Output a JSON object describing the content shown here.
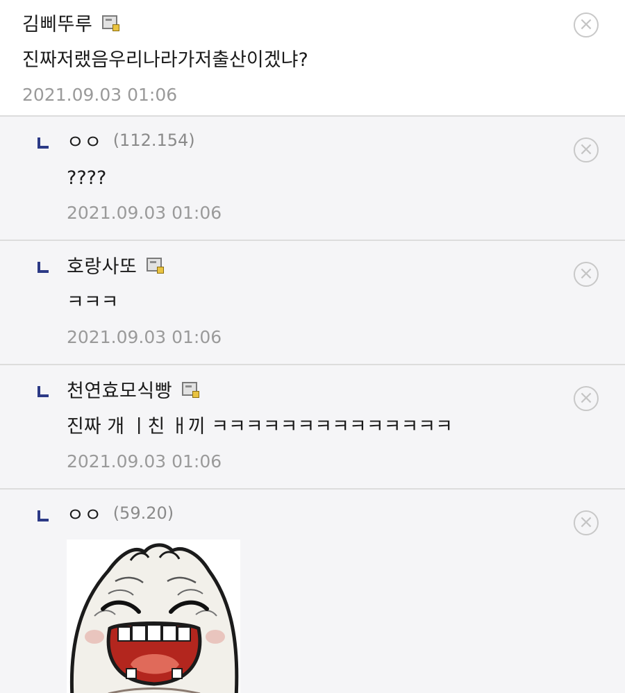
{
  "comments": [
    {
      "nickname": "김삐뚜루",
      "body": "진짜저랬음우리나라가저출산이겠냐?",
      "time": "2021.09.03 01:06",
      "delete_icon": "×"
    },
    {
      "nickname": "ㅇㅇ",
      "ip": "(112.154)",
      "body": "????",
      "time": "2021.09.03 01:06",
      "delete_icon": "×"
    },
    {
      "nickname": "호랑사또",
      "body": "ㅋㅋㅋ",
      "time": "2021.09.03 01:06",
      "delete_icon": "×"
    },
    {
      "nickname": "천연효모식빵",
      "body": "진짜 개 ㅣ친 ㅐ끼 ㅋㅋㅋㅋㅋㅋㅋㅋㅋㅋㅋㅋㅋㅋ",
      "time": "2021.09.03 01:06",
      "delete_icon": "×"
    },
    {
      "nickname": "ㅇㅇ",
      "ip": "(59.20)",
      "delete_icon": "×"
    }
  ],
  "icons": {
    "reply": "reply-arrow-icon",
    "member": "fixed-member-icon",
    "delete": "circle-x-icon"
  },
  "colors": {
    "reply_bg": "#f5f5f7",
    "reply_mark": "#2c3a86",
    "timestamp": "#9a9a9a"
  }
}
